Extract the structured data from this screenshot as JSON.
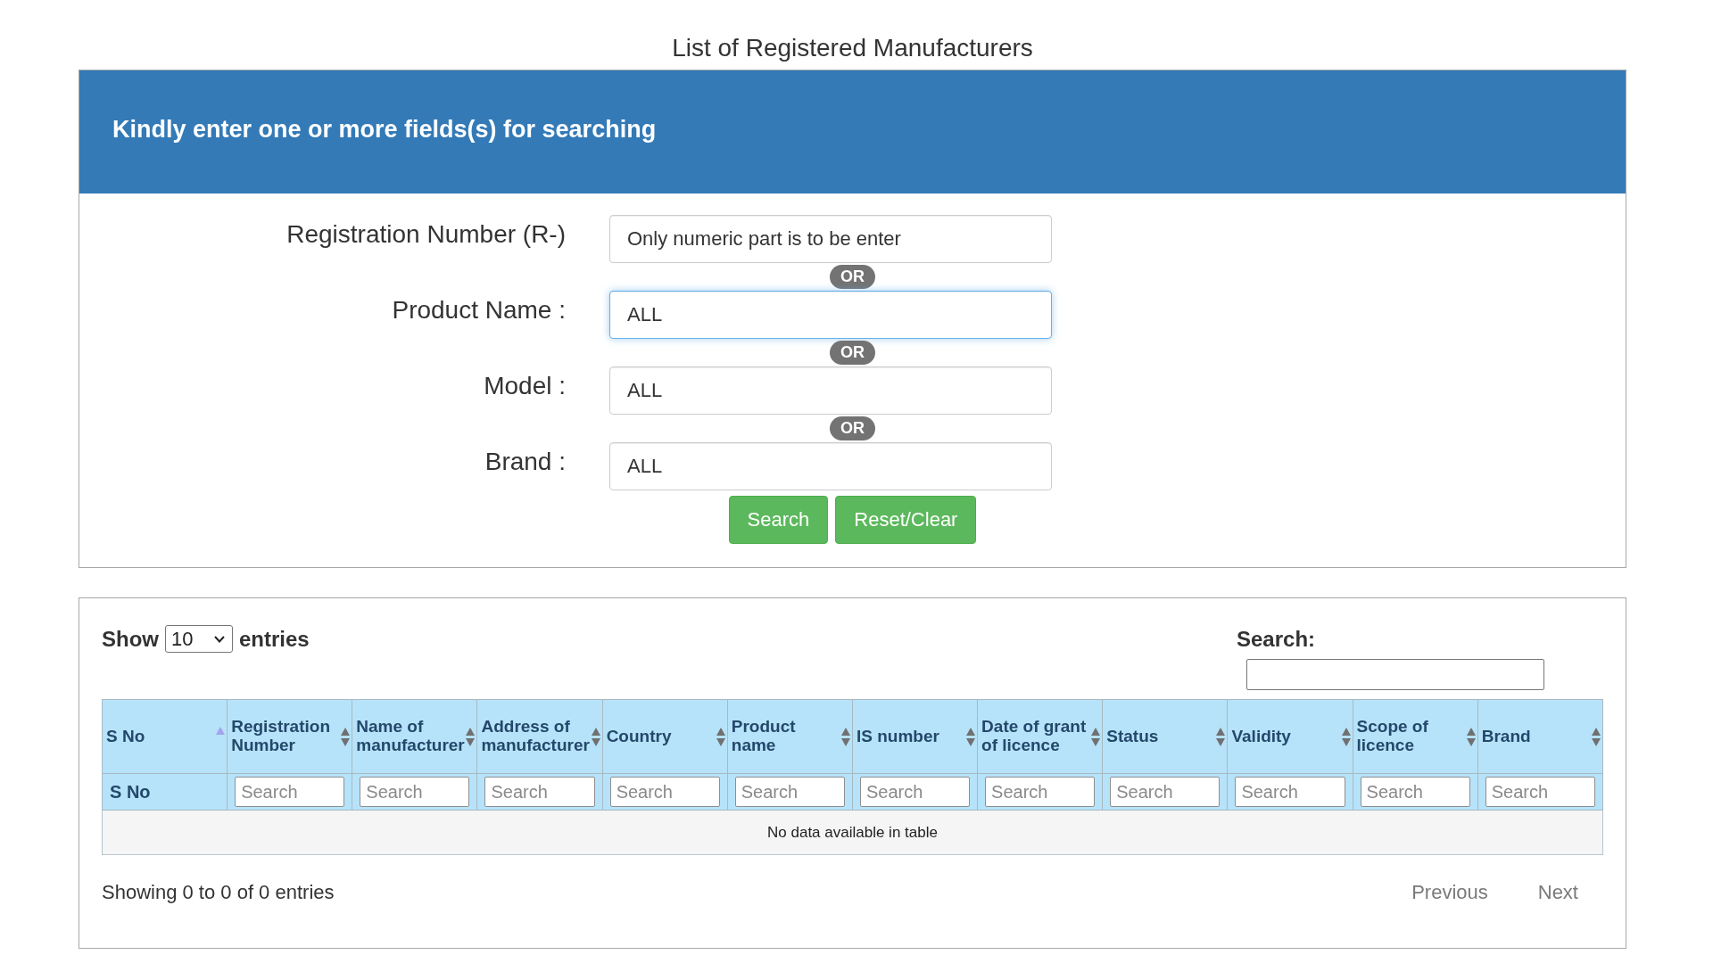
{
  "page": {
    "title": "List of Registered Manufacturers"
  },
  "search_panel": {
    "heading": "Kindly enter one or more fields(s) for searching",
    "fields": [
      {
        "label": "Registration Number (R-)",
        "placeholder": "Only numeric part is to be enter",
        "focused": false,
        "separator": "OR"
      },
      {
        "label": "Product Name :",
        "value": "ALL",
        "focused": true,
        "separator": "OR"
      },
      {
        "label": "Model :",
        "value": "ALL",
        "focused": false,
        "separator": "OR"
      },
      {
        "label": "Brand :",
        "value": "ALL",
        "focused": false
      }
    ],
    "buttons": [
      {
        "label": "Search"
      },
      {
        "label": "Reset/Clear"
      }
    ]
  },
  "results_panel": {
    "length_menu": {
      "prefix": "Show",
      "value": "10",
      "suffix": "entries"
    },
    "search": {
      "label": "Search:"
    },
    "table": {
      "columns": [
        {
          "label": "S No",
          "sorted": true
        },
        {
          "label": "Registration Number",
          "sorted": false
        },
        {
          "label": "Name of manufacturer",
          "sorted": false
        },
        {
          "label": "Address of manufacturer",
          "sorted": false
        },
        {
          "label": "Country",
          "sorted": false
        },
        {
          "label": "Product name",
          "sorted": false
        },
        {
          "label": "IS number",
          "sorted": false
        },
        {
          "label": "Date of grant of licence",
          "sorted": false
        },
        {
          "label": "Status",
          "sorted": false
        },
        {
          "label": "Validity",
          "sorted": false
        },
        {
          "label": "Scope of licence",
          "sorted": false
        },
        {
          "label": "Brand",
          "sorted": false
        }
      ],
      "filters": [
        {
          "kind": "label",
          "text": "S No"
        },
        {
          "kind": "input",
          "placeholder": "Search"
        },
        {
          "kind": "input",
          "placeholder": "Search"
        },
        {
          "kind": "input",
          "placeholder": "Search"
        },
        {
          "kind": "input",
          "placeholder": "Search"
        },
        {
          "kind": "input",
          "placeholder": "Search"
        },
        {
          "kind": "input",
          "placeholder": "Search"
        },
        {
          "kind": "input",
          "placeholder": "Search"
        },
        {
          "kind": "input",
          "placeholder": "Search"
        },
        {
          "kind": "input",
          "placeholder": "Search"
        },
        {
          "kind": "input",
          "placeholder": "Search"
        },
        {
          "kind": "input",
          "placeholder": "Search"
        }
      ],
      "empty_message": "No data available in table"
    },
    "info": "Showing 0 to 0 of 0 entries",
    "pagination": [
      {
        "label": "Previous",
        "disabled": true
      },
      {
        "label": "Next",
        "disabled": true
      }
    ]
  }
}
